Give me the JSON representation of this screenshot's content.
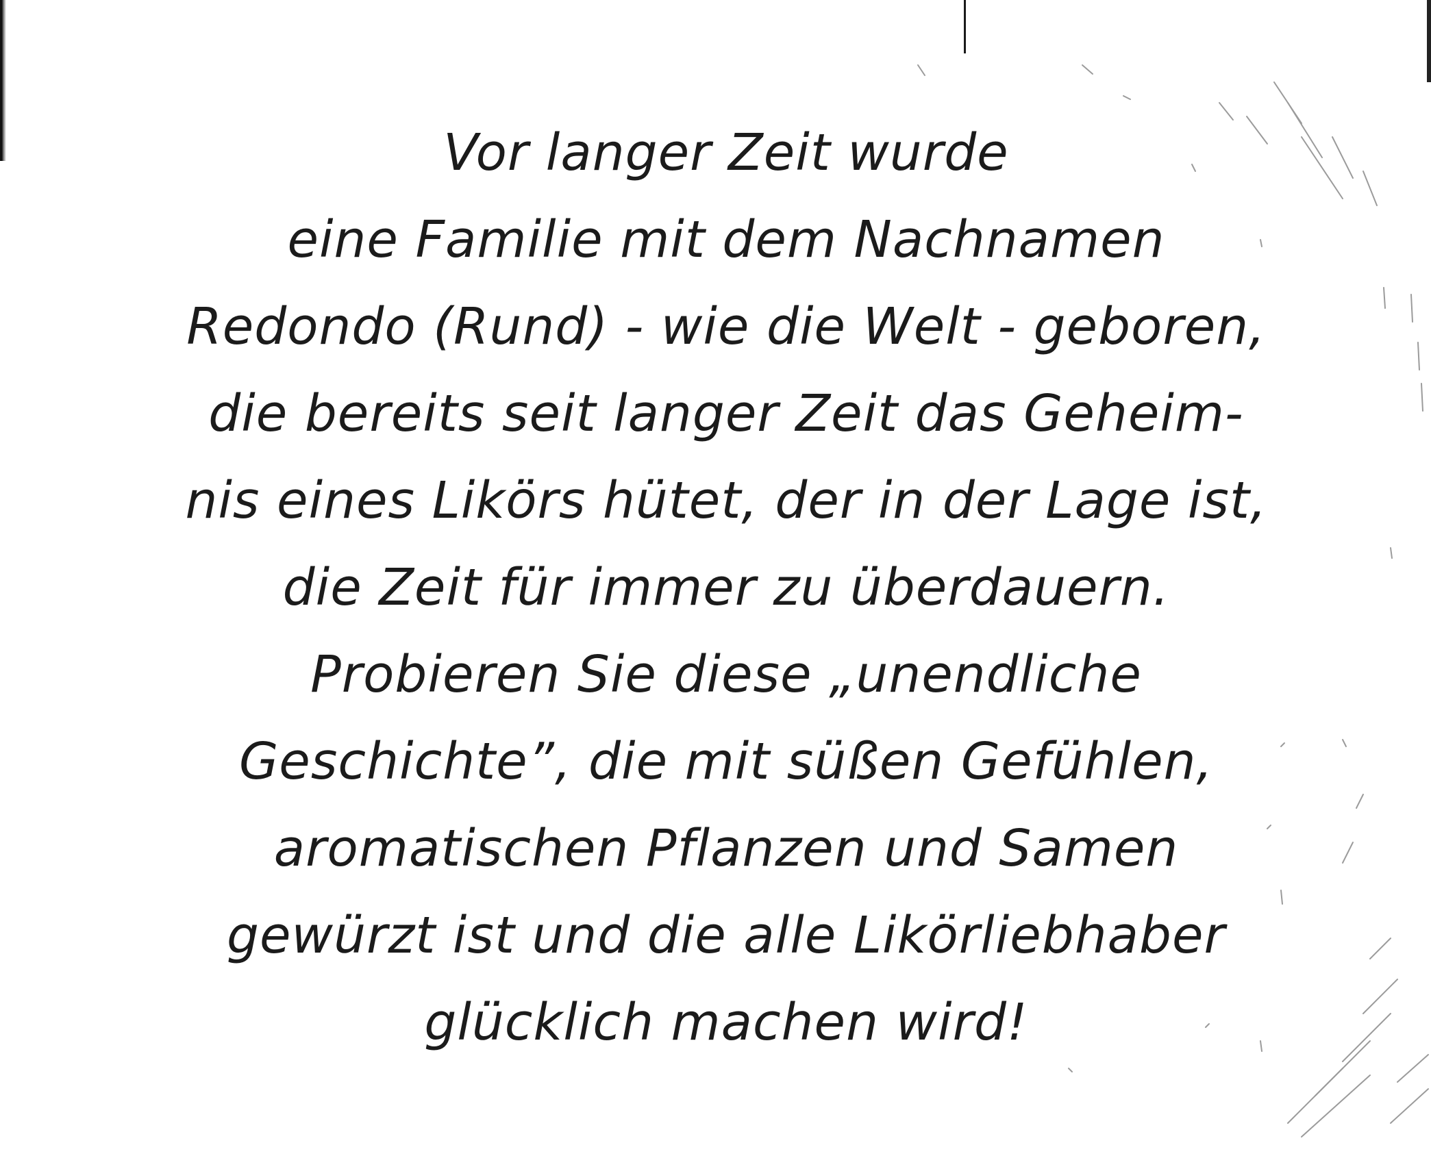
{
  "text": {
    "lines": [
      "Vor langer Zeit wurde",
      "eine Familie mit dem Nachnamen",
      "Redondo (Rund) - wie die Welt - geboren,",
      "die bereits seit langer Zeit das Geheim-",
      "nis eines Likörs hütet, der in der Lage ist,",
      "die Zeit für immer zu überdauern.",
      "Probieren Sie diese „unendliche",
      "Geschichte”, die mit süßen Gefühlen,",
      "aromatischen Pflanzen und Samen",
      "gewürzt ist und die alle Likörliebhaber",
      "glücklich machen wird!"
    ]
  },
  "colors": {
    "background": "#ffffff",
    "ink": "#1b1b1b"
  }
}
